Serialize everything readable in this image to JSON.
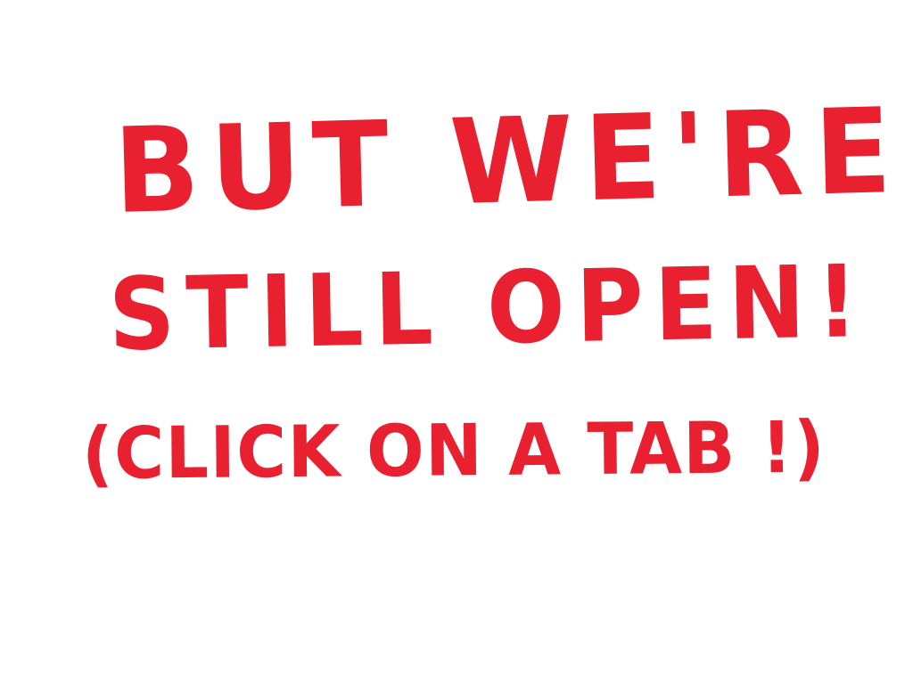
{
  "sign": {
    "line1": "BUT WE'RE",
    "line2": "STILL OPEN!",
    "line3": "(CLICK ON A TAB !)"
  },
  "colors": {
    "background": "#ffffff",
    "ink": "#e8202f"
  }
}
